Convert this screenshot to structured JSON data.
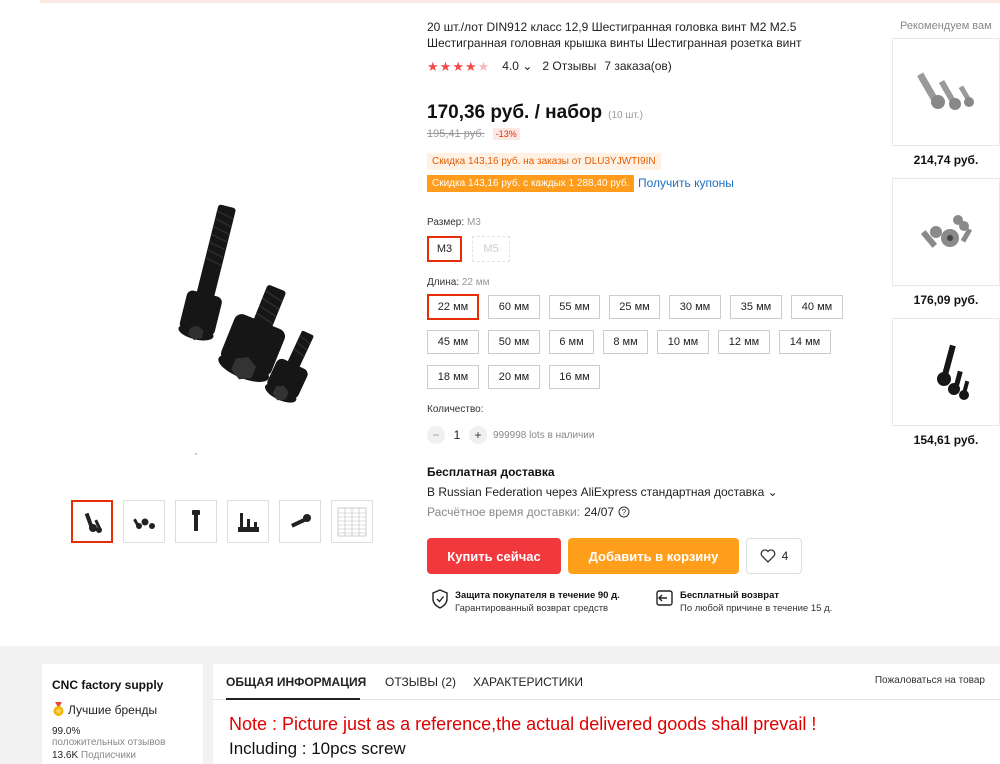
{
  "product": {
    "title": "20 шт./лот DIN912 класс 12,9 Шестигранная головка винт M2 M2.5 Шестигранная головная крышка винты Шестигранная розетка винт",
    "rating": "4.0",
    "reviews": "2 Отзывы",
    "orders": "7 заказа(ов)",
    "price": "170,36 руб. / набор",
    "price_unit": "(10 шт.)",
    "old_price": "195,41 руб.",
    "discount": "-13%",
    "coupon_code_text": "Скидка 143,16 руб. на заказы от DLU3YJWTI9IN",
    "coupon_every_text": "Скидка 143,16 руб. с каждых 1 288,40 руб.",
    "get_coupons": "Получить купоны"
  },
  "size": {
    "label": "Размер:",
    "value": "M3",
    "options": [
      "M3",
      "M5"
    ]
  },
  "length": {
    "label": "Длина:",
    "value": "22 мм",
    "options": [
      "22 мм",
      "60 мм",
      "55 мм",
      "25 мм",
      "30 мм",
      "35 мм",
      "40 мм",
      "45 мм",
      "50 мм",
      "6 мм",
      "8 мм",
      "10 мм",
      "12 мм",
      "14 мм",
      "18 мм",
      "20 мм",
      "16 мм"
    ]
  },
  "quantity": {
    "label": "Количество:",
    "minus": "−",
    "plus": "+",
    "value": "1",
    "available": "999998 lots в наличии"
  },
  "shipping": {
    "title": "Бесплатная доставка",
    "line": "В Russian Federation через AliExpress стандартная доставка",
    "time_label": "Расчётное время доставки:",
    "time_value": "24/07"
  },
  "actions": {
    "buy": "Купить сейчас",
    "cart": "Добавить в корзину",
    "wish_count": "4"
  },
  "guarantees": [
    {
      "title": "Защита покупателя в течение 90 д.",
      "sub": "Гарантированный возврат средств"
    },
    {
      "title": "Бесплатный возврат",
      "sub": "По любой причине в течение 15 д."
    }
  ],
  "recommend": {
    "title": "Рекомендуем вам",
    "items": [
      {
        "price": "214,74 руб."
      },
      {
        "price": "176,09 руб."
      },
      {
        "price": "154,61 руб."
      }
    ]
  },
  "store": {
    "name": "CNC factory supply",
    "badge": "Лучшие бренды",
    "positive_pct": "99.0%",
    "positive_label": "положительных отзывов",
    "followers": "13.6K",
    "followers_label": "Подписчики"
  },
  "tabs": {
    "info": "ОБЩАЯ ИНФОРМАЦИЯ",
    "reviews": "ОТЗЫВЫ (2)",
    "specs": "ХАРАКТЕРИСТИКИ",
    "report": "Пожаловаться на товар"
  },
  "description": {
    "note": "Note : Picture just as a reference,the actual delivered goods shall prevail !",
    "including": "Including : 10pcs screw"
  },
  "colors": {
    "accent_red": "#f1383c",
    "accent_orange": "#ff9e1b",
    "link_blue": "#1e6fc0",
    "star": "#f44a4a"
  }
}
